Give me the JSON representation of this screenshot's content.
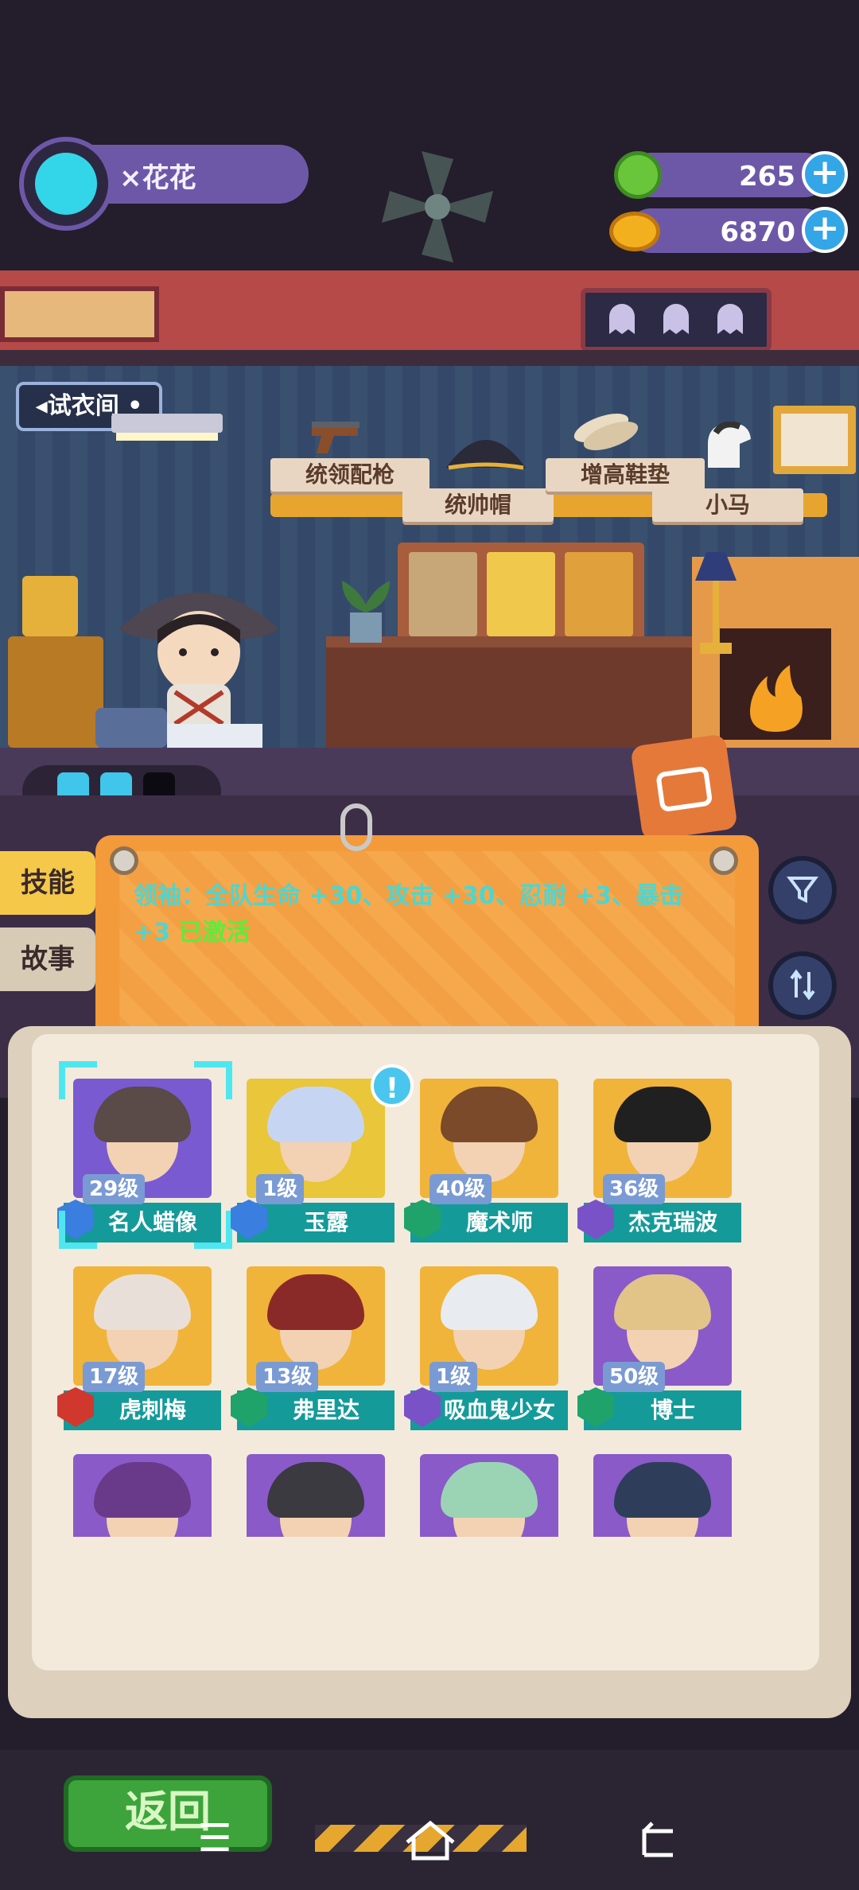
{
  "profile": {
    "username": "×花花"
  },
  "currencies": [
    {
      "name": "gem",
      "value": "265"
    },
    {
      "name": "coin",
      "value": "6870"
    }
  ],
  "scene": {
    "fitting_room_label": "试衣间",
    "items": [
      "统领配枪",
      "统帅帽",
      "增高鞋垫",
      "小马"
    ]
  },
  "tabs": [
    "技能",
    "故事"
  ],
  "skill": {
    "text": "领袖：全队生命 +30、攻击 +30、忍耐 +3、暴击 +3",
    "status": "已激活"
  },
  "characters": [
    {
      "level": "29级",
      "name": "名人蜡像",
      "badge_color": "#3a7ee0",
      "bg": "#7a5ad0",
      "hair": "#5a4a48",
      "selected": true
    },
    {
      "level": "1级",
      "name": "玉露",
      "badge_color": "#3a7ee0",
      "bg": "#e9c63a",
      "hair": "#c6d6f2",
      "selected": false
    },
    {
      "level": "40级",
      "name": "魔术师",
      "badge_color": "#1fa36a",
      "bg": "#f0b43a",
      "hair": "#7a4a2a",
      "selected": false
    },
    {
      "level": "36级",
      "name": "杰克瑞波",
      "badge_color": "#7a52c8",
      "bg": "#f0b43a",
      "hair": "#202020",
      "selected": false
    },
    {
      "level": "17级",
      "name": "虎刺梅",
      "badge_color": "#d0382e",
      "bg": "#f0b43a",
      "hair": "#e8e0d8",
      "selected": false
    },
    {
      "level": "13级",
      "name": "弗里达",
      "badge_color": "#1fa36a",
      "bg": "#f0b43a",
      "hair": "#8a2a28",
      "selected": false
    },
    {
      "level": "1级",
      "name": "吸血鬼少女",
      "badge_color": "#7a52c8",
      "bg": "#f0b43a",
      "hair": "#e8ecf0",
      "selected": false
    },
    {
      "level": "50级",
      "name": "博士",
      "badge_color": "#1fa36a",
      "bg": "#8a5ac8",
      "hair": "#e2c488",
      "selected": false
    },
    {
      "level": "",
      "name": "",
      "badge_color": "",
      "bg": "#8a5ac8",
      "hair": "#6a3a8a",
      "selected": false
    },
    {
      "level": "",
      "name": "",
      "badge_color": "",
      "bg": "#8a5ac8",
      "hair": "#3a3a40",
      "selected": false
    },
    {
      "level": "",
      "name": "",
      "badge_color": "",
      "bg": "#8a5ac8",
      "hair": "#9ad4b4",
      "selected": false
    },
    {
      "level": "",
      "name": "",
      "badge_color": "",
      "bg": "#8a5ac8",
      "hair": "#2e3e5a",
      "selected": false
    }
  ],
  "bottom": {
    "back_label": "返回"
  },
  "icons": [
    "filter-icon",
    "sort-icon",
    "menu-icon",
    "home-icon",
    "back-nav-icon"
  ]
}
